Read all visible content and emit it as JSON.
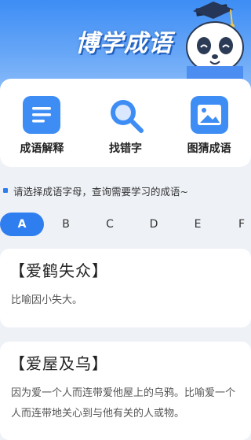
{
  "header": {
    "title": "博学成语"
  },
  "features": [
    {
      "label": "成语解释",
      "icon": "list-icon"
    },
    {
      "label": "找错字",
      "icon": "search-icon"
    },
    {
      "label": "图猜成语",
      "icon": "image-icon"
    }
  ],
  "tip": {
    "text": "请选择成语字母，查询需要学习的成语~"
  },
  "letters": {
    "items": [
      "A",
      "B",
      "C",
      "D",
      "E",
      "F"
    ],
    "selected": "A"
  },
  "idioms": [
    {
      "title": "【爱鹤失众】",
      "desc": "比喻因小失大。"
    },
    {
      "title": "【爱屋及乌】",
      "desc": "因为爱一个人而连带爱他屋上的乌鸦。比喻爱一个人而连带地关心到与他有关的人或物。"
    }
  ],
  "colors": {
    "accent": "#2f7ef0",
    "hero": "#3d8df5"
  }
}
